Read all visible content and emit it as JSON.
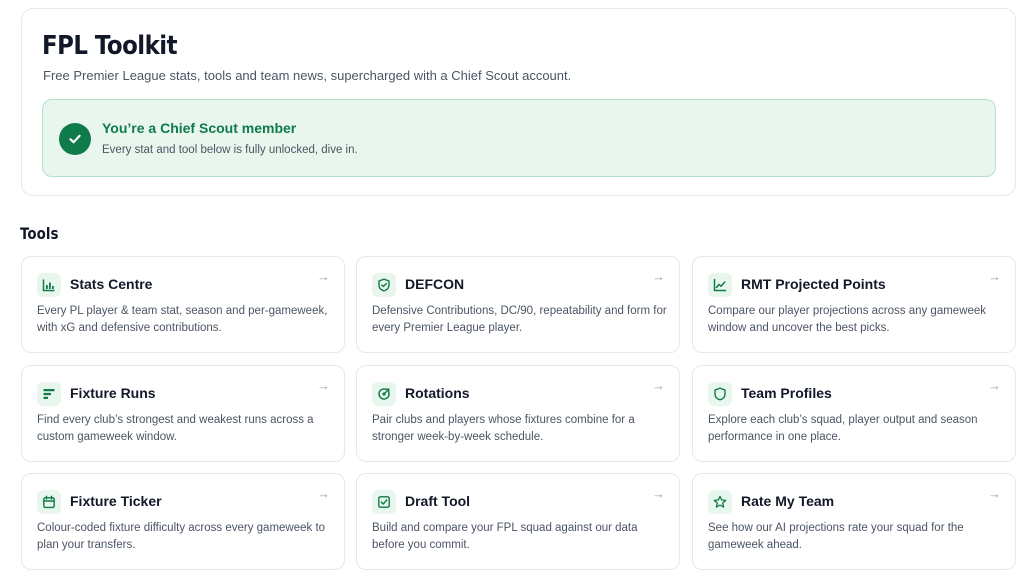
{
  "header": {
    "title": "FPL Toolkit",
    "subtitle": "Free Premier League stats, tools and team news, supercharged with a Chief Scout account."
  },
  "membership": {
    "title": "You’re a Chief Scout member",
    "text": "Every stat and tool below is fully unlocked, dive in.",
    "icon": "check-circle-icon"
  },
  "tools_section": {
    "title": "Tools",
    "arrow": "→",
    "cards": [
      {
        "title": "Stats Centre",
        "desc": "Every PL player & team stat, season and per-gameweek, with xG and defensive contributions.",
        "icon": "bar-chart-icon"
      },
      {
        "title": "DEFCON",
        "desc": "Defensive Contributions, DC/90, repeatability and form for every Premier League player.",
        "icon": "shield-check-icon"
      },
      {
        "title": "RMT Projected Points",
        "desc": "Compare our player projections across any gameweek window and uncover the best picks.",
        "icon": "trend-chart-icon"
      },
      {
        "title": "Fixture Runs",
        "desc": "Find every club’s strongest and weakest runs across a custom gameweek window.",
        "icon": "list-bars-icon"
      },
      {
        "title": "Rotations",
        "desc": "Pair clubs and players whose fixtures combine for a stronger week-by-week schedule.",
        "icon": "target-icon"
      },
      {
        "title": "Team Profiles",
        "desc": "Explore each club’s squad, player output and season performance in one place.",
        "icon": "shield-icon"
      },
      {
        "title": "Fixture Ticker",
        "desc": "Colour-coded fixture difficulty across every gameweek to plan your transfers.",
        "icon": "calendar-icon"
      },
      {
        "title": "Draft Tool",
        "desc": "Build and compare your FPL squad against our data before you commit.",
        "icon": "checkbox-icon"
      },
      {
        "title": "Rate My Team",
        "desc": "See how our AI projections rate your squad for the gameweek ahead.",
        "icon": "star-icon"
      }
    ]
  },
  "colors": {
    "accent_green": "#0f7a4a",
    "banner_bg": "#e8f6ee",
    "banner_border": "#b5e3c8"
  }
}
